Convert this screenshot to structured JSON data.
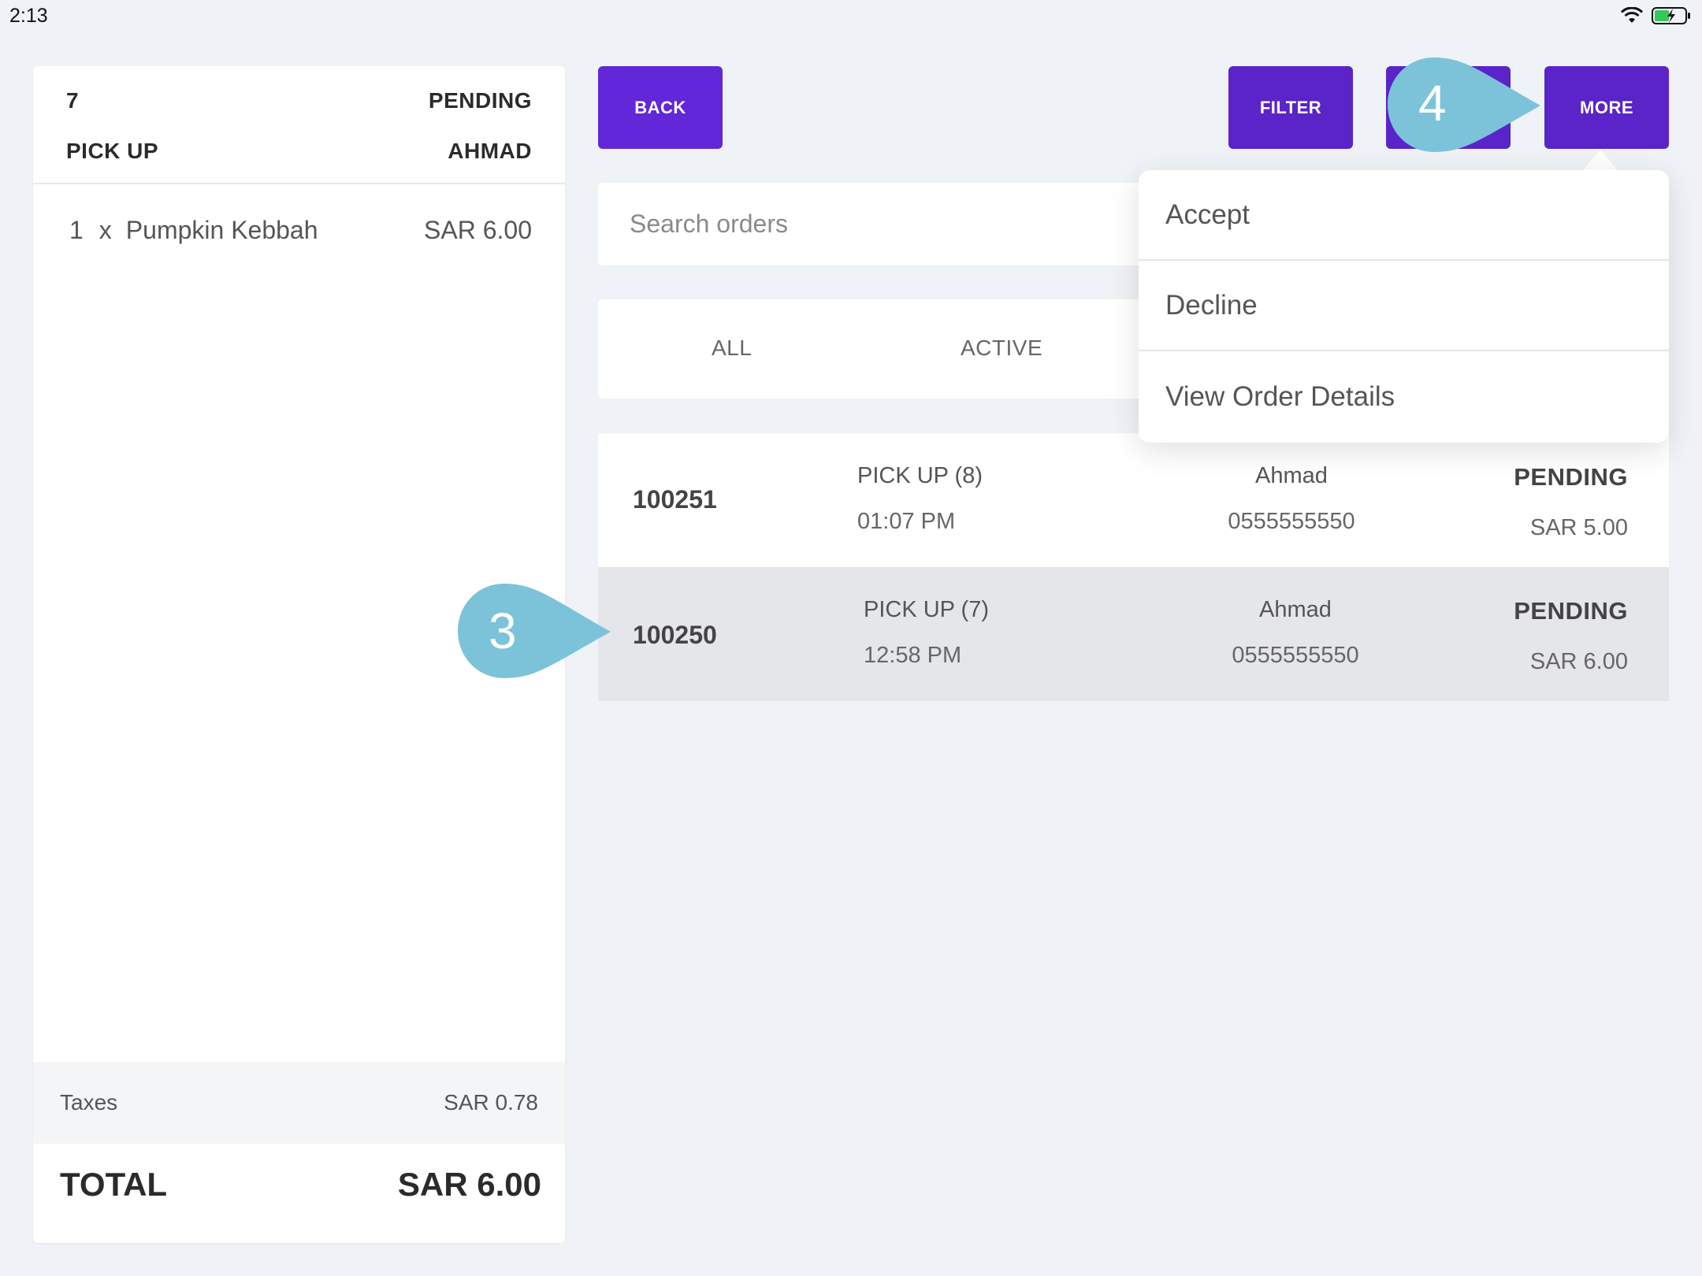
{
  "status_bar": {
    "time": "2:13"
  },
  "order_detail": {
    "number": "7",
    "status": "PENDING",
    "type": "PICK UP",
    "customer": "AHMAD",
    "items": [
      {
        "qty": "1",
        "x": "x",
        "name": "Pumpkin Kebbah",
        "price": "SAR 6.00"
      }
    ],
    "taxes_label": "Taxes",
    "taxes_value": "SAR 0.78",
    "total_label": "TOTAL",
    "total_value": "SAR 6.00"
  },
  "toolbar": {
    "back_label": "BACK",
    "filter_label": "FILTER",
    "more_label": "MORE"
  },
  "search": {
    "placeholder": "Search orders"
  },
  "tabs": [
    {
      "label": "ALL"
    },
    {
      "label": "ACTIVE"
    }
  ],
  "orders": [
    {
      "id": "100251",
      "type": "PICK UP (8)",
      "time": "01:07 PM",
      "name": "Ahmad",
      "phone": "0555555550",
      "status": "PENDING",
      "price": "SAR 5.00"
    },
    {
      "id": "100250",
      "type": "PICK UP (7)",
      "time": "12:58 PM",
      "name": "Ahmad",
      "phone": "0555555550",
      "status": "PENDING",
      "price": "SAR 6.00"
    }
  ],
  "menu": {
    "items": [
      {
        "label": "Accept"
      },
      {
        "label": "Decline"
      },
      {
        "label": "View Order Details"
      }
    ]
  },
  "callouts": [
    {
      "number": "3"
    },
    {
      "number": "4"
    }
  ],
  "colors": {
    "primary": "#5f26d4",
    "callout": "#7cc3da",
    "background": "#eff2f6"
  }
}
